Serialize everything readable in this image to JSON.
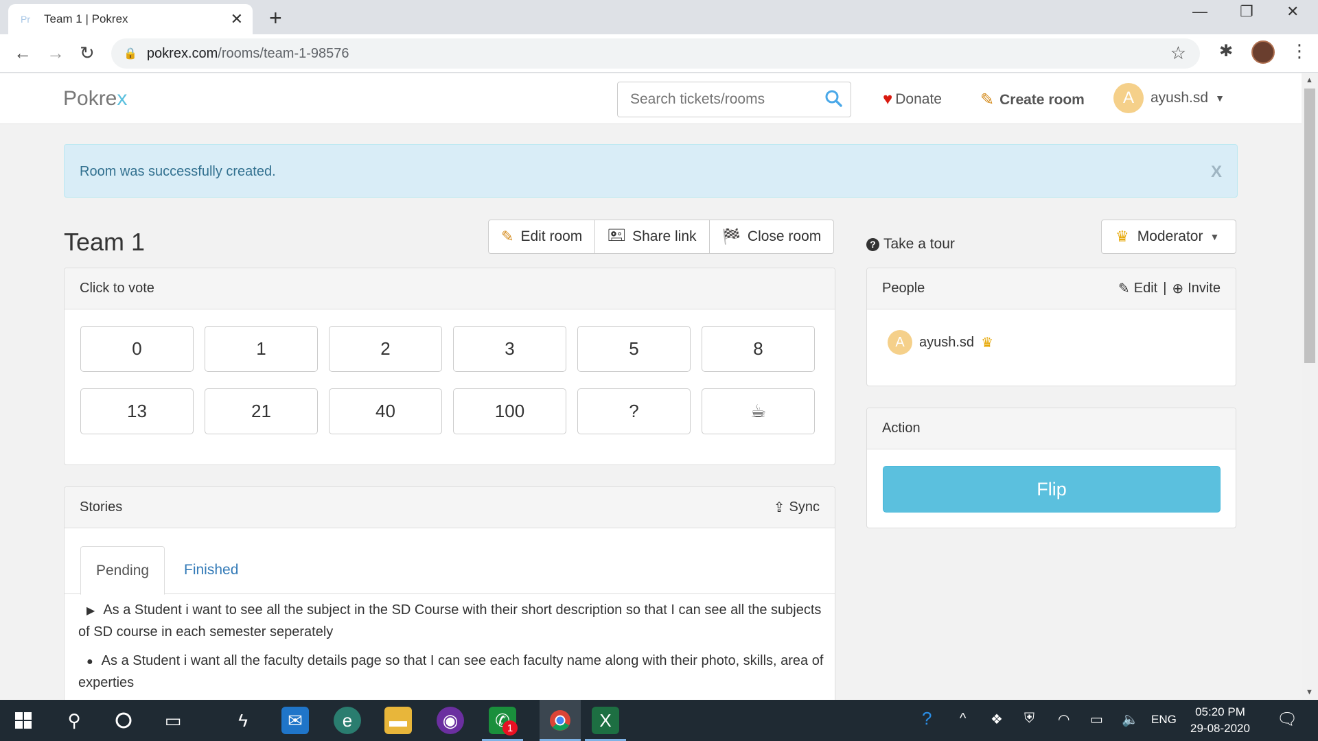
{
  "browser": {
    "tab_favicon": "Pr",
    "tab_title": "Team 1 | Pokrex",
    "url_host": "pokrex.com",
    "url_path": "/rooms/team-1-98576"
  },
  "site": {
    "brand_main": "Pokre",
    "brand_accent": "x",
    "search_placeholder": "Search tickets/rooms",
    "donate_label": "Donate",
    "create_room_label": "Create room",
    "user_initial": "A",
    "username": "ayush.sd"
  },
  "alert": {
    "message": "Room was successfully created.",
    "close": "X"
  },
  "room": {
    "title": "Team 1",
    "edit_label": "Edit room",
    "share_label": "Share link",
    "close_label": "Close room",
    "tour_label": "Take a tour",
    "moderator_label": "Moderator"
  },
  "vote": {
    "heading": "Click to vote",
    "cards": [
      "0",
      "1",
      "2",
      "3",
      "5",
      "8",
      "13",
      "21",
      "40",
      "100",
      "?",
      "☕"
    ]
  },
  "stories": {
    "heading": "Stories",
    "sync_label": "Sync",
    "tab_pending": "Pending",
    "tab_finished": "Finished",
    "items": [
      "As a Student i want to see all the subject in the SD Course with their short description so that I can see all the subjects of SD course in each semester seperately",
      "As a Student i want all the faculty details page so that I can see each faculty name along with their photo, skills, area of experties"
    ]
  },
  "people": {
    "heading": "People",
    "edit_label": "Edit",
    "separator": "|",
    "invite_label": "Invite",
    "members": [
      {
        "initial": "A",
        "name": "ayush.sd"
      }
    ]
  },
  "action": {
    "heading": "Action",
    "flip_label": "Flip"
  },
  "taskbar": {
    "lang": "ENG",
    "time": "05:20 PM",
    "date": "29-08-2020",
    "notification_badge": "1"
  },
  "colors": {
    "accent": "#5bc0de",
    "alert_bg": "#d9edf7",
    "alert_text": "#31708f",
    "link": "#337ab7",
    "heart": "#d9190f"
  }
}
